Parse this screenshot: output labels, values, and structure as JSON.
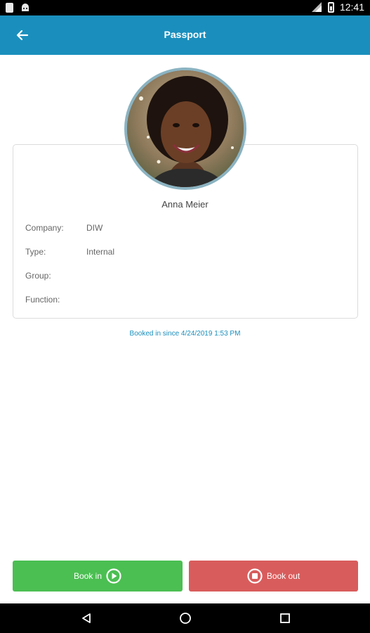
{
  "status_bar": {
    "time": "12:41",
    "left_icons": [
      "notification-icon",
      "android-icon"
    ],
    "right_icons": [
      "signal-icon",
      "battery-icon"
    ]
  },
  "app_bar": {
    "title": "Passport",
    "back_icon": "arrow-left-icon",
    "color": "#1a8fbd"
  },
  "profile": {
    "name": "Anna Meier",
    "photo": "avatar-photo",
    "fields": [
      {
        "label": "Company:",
        "value": "DIW"
      },
      {
        "label": "Type:",
        "value": "Internal"
      },
      {
        "label": "Group:",
        "value": ""
      },
      {
        "label": "Function:",
        "value": ""
      }
    ]
  },
  "booking": {
    "status_text": "Booked in since 4/24/2019 1:53 PM"
  },
  "actions": {
    "book_in_label": "Book in",
    "book_in_icon": "play-circle-icon",
    "book_in_color": "#4bbf52",
    "book_out_label": "Book out",
    "book_out_icon": "stop-circle-icon",
    "book_out_color": "#d95c5c"
  },
  "nav_bar": {
    "icons": [
      "back-triangle-icon",
      "home-circle-icon",
      "recents-square-icon"
    ]
  }
}
